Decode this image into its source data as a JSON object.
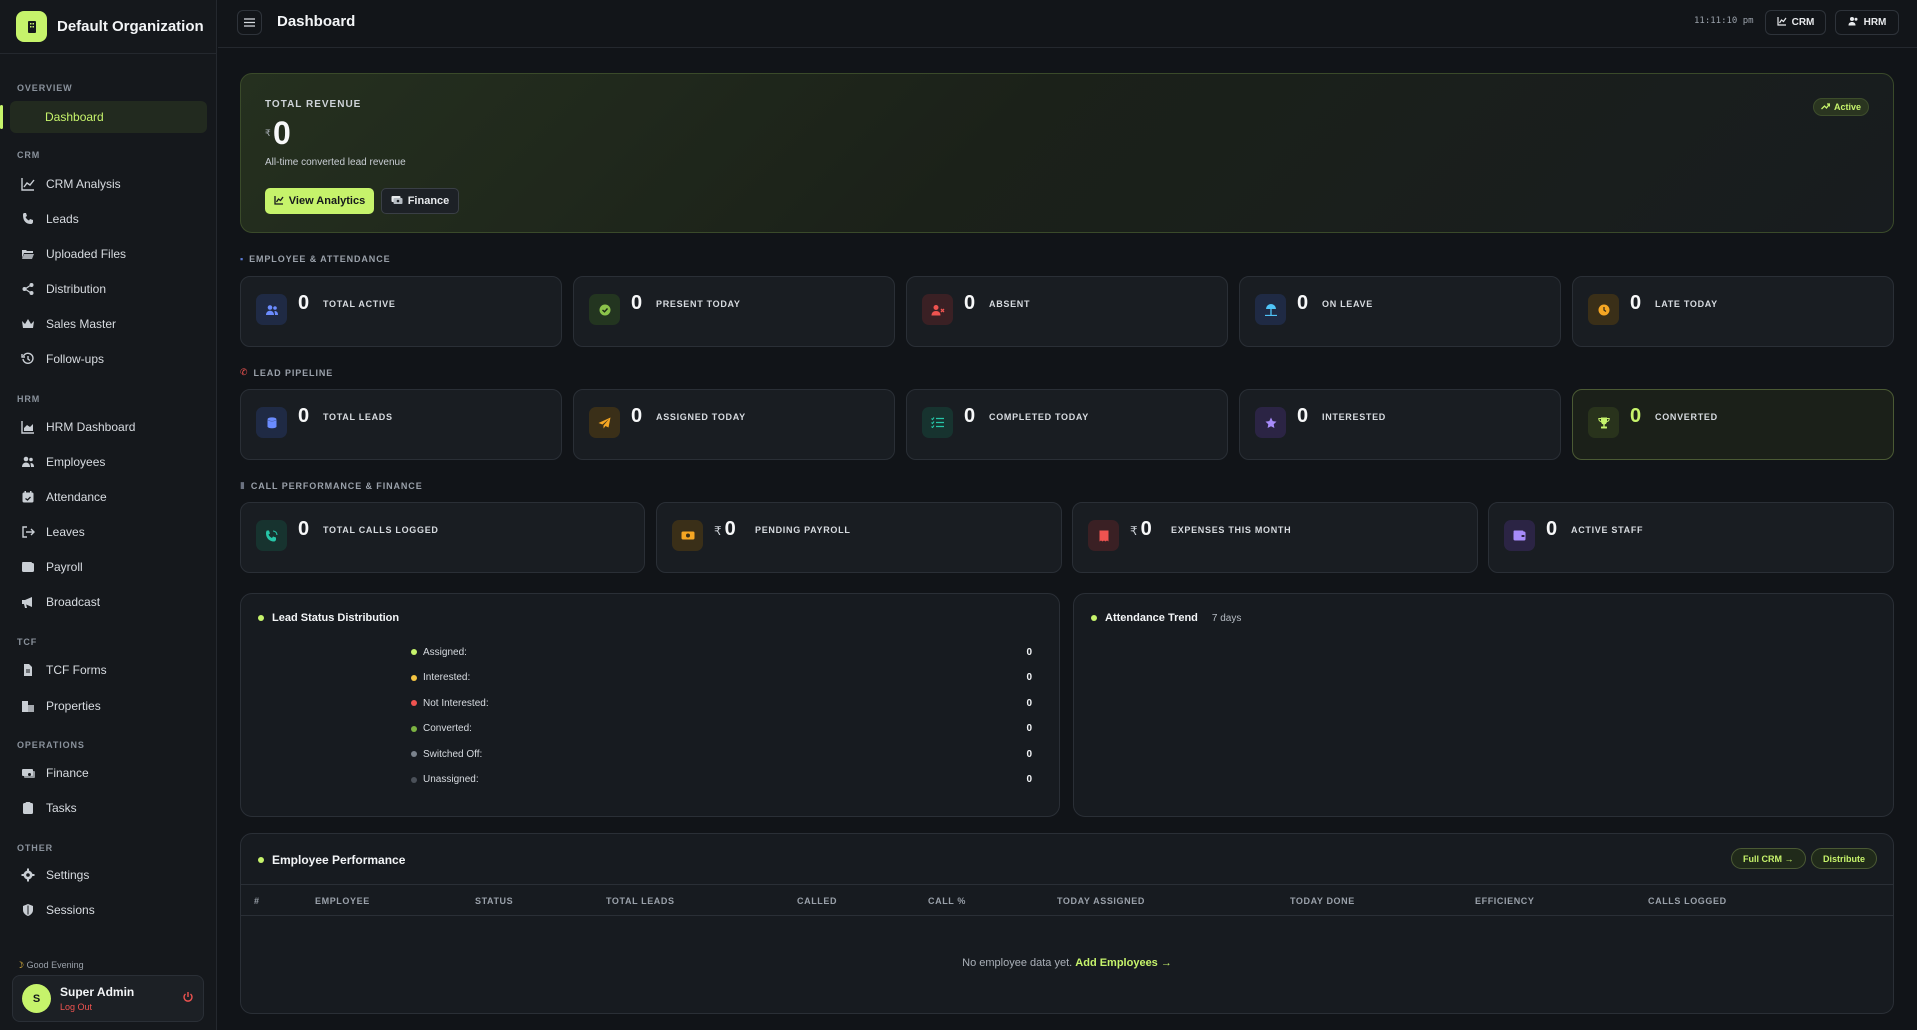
{
  "org": {
    "name": "Default Organization"
  },
  "sidebar": {
    "sections": {
      "overview": "OVERVIEW",
      "crm": "CRM",
      "hrm": "HRM",
      "tcf": "TCF",
      "operations": "OPERATIONS",
      "other": "OTHER"
    },
    "items": {
      "dashboard": "Dashboard",
      "crm_analysis": "CRM Analysis",
      "leads": "Leads",
      "uploaded_files": "Uploaded Files",
      "distribution": "Distribution",
      "sales_master": "Sales Master",
      "follow_ups": "Follow-ups",
      "hrm_dashboard": "HRM Dashboard",
      "employees": "Employees",
      "attendance": "Attendance",
      "leaves": "Leaves",
      "payroll": "Payroll",
      "broadcast": "Broadcast",
      "tcf_forms": "TCF Forms",
      "properties": "Properties",
      "finance": "Finance",
      "tasks": "Tasks",
      "settings": "Settings",
      "sessions": "Sessions"
    },
    "greeting": "Good Evening",
    "user": {
      "initial": "S",
      "name": "Super Admin",
      "logout": "Log Out"
    }
  },
  "topbar": {
    "title": "Dashboard",
    "clock": "11:11:10 pm",
    "crm_label": "CRM",
    "hrm_label": "HRM"
  },
  "hero": {
    "label": "TOTAL REVENUE",
    "currency": "₹",
    "value": "0",
    "subtitle": "All-time converted lead revenue",
    "analytics_button": "View Analytics",
    "finance_button": "Finance",
    "badge": "Active"
  },
  "sections": {
    "employee": "EMPLOYEE & ATTENDANCE",
    "pipeline": "LEAD PIPELINE",
    "calls": "CALL PERFORMANCE & FINANCE"
  },
  "employee_stats": [
    {
      "value": "0",
      "label": "TOTAL ACTIVE"
    },
    {
      "value": "0",
      "label": "PRESENT TODAY"
    },
    {
      "value": "0",
      "label": "ABSENT"
    },
    {
      "value": "0",
      "label": "ON LEAVE"
    },
    {
      "value": "0",
      "label": "LATE TODAY"
    }
  ],
  "pipeline_stats": [
    {
      "value": "0",
      "label": "TOTAL LEADS"
    },
    {
      "value": "0",
      "label": "ASSIGNED TODAY"
    },
    {
      "value": "0",
      "label": "COMPLETED TODAY"
    },
    {
      "value": "0",
      "label": "INTERESTED"
    },
    {
      "value": "0",
      "label": "CONVERTED"
    }
  ],
  "call_stats": [
    {
      "currency": "",
      "value": "0",
      "label": "TOTAL CALLS LOGGED"
    },
    {
      "currency": "₹",
      "value": "0",
      "label": "PENDING PAYROLL"
    },
    {
      "currency": "₹",
      "value": "0",
      "label": "EXPENSES THIS MONTH"
    },
    {
      "currency": "",
      "value": "0",
      "label": "ACTIVE STAFF"
    }
  ],
  "lead_status": {
    "title": "Lead Status Distribution",
    "rows": [
      {
        "label": "Assigned:",
        "value": "0",
        "color": "#c6f36b"
      },
      {
        "label": "Interested:",
        "value": "0",
        "color": "#f5c542"
      },
      {
        "label": "Not Interested:",
        "value": "0",
        "color": "#ef5350"
      },
      {
        "label": "Converted:",
        "value": "0",
        "color": "#7cb342"
      },
      {
        "label": "Switched Off:",
        "value": "0",
        "color": "#7a828c"
      },
      {
        "label": "Unassigned:",
        "value": "0",
        "color": "#4a5058"
      }
    ]
  },
  "attendance_trend": {
    "title": "Attendance Trend",
    "period": "7 days"
  },
  "performance": {
    "title": "Employee Performance",
    "full_crm": "Full CRM →",
    "distribute": "Distribute",
    "columns": [
      "#",
      "EMPLOYEE",
      "STATUS",
      "TOTAL LEADS",
      "CALLED",
      "CALL %",
      "TODAY ASSIGNED",
      "TODAY DONE",
      "EFFICIENCY",
      "CALLS LOGGED"
    ],
    "empty_text": "No employee data yet.",
    "empty_link": "Add Employees →"
  },
  "colors": {
    "accent": "#c6f36b",
    "danger": "#ef5350"
  }
}
